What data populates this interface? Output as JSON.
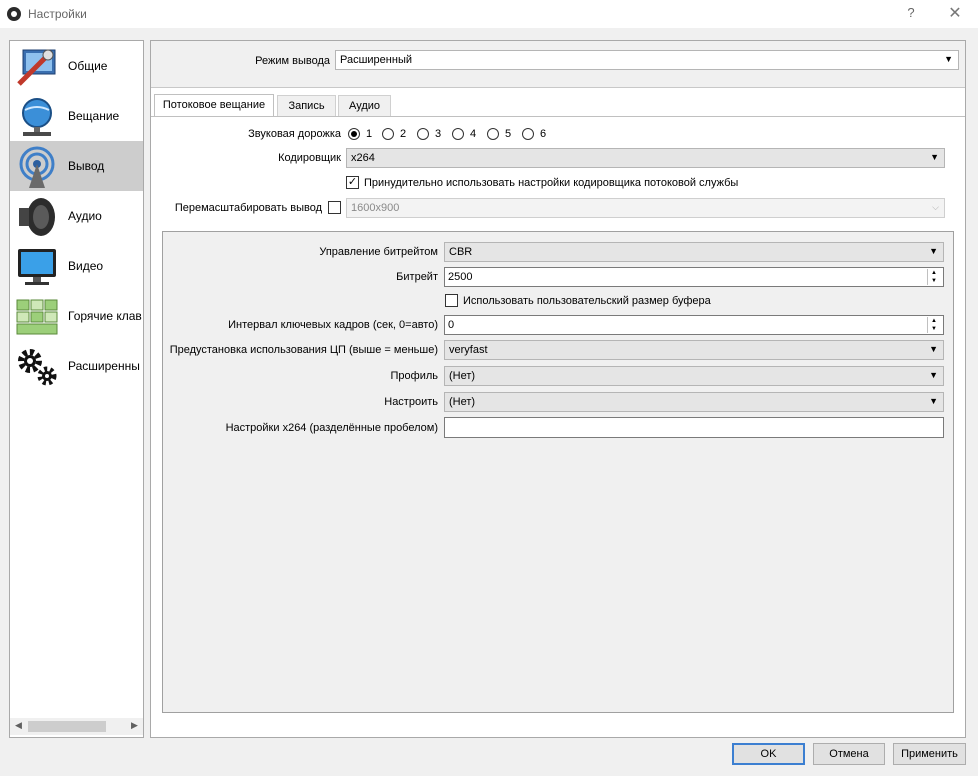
{
  "window": {
    "title": "Настройки",
    "help": "?",
    "close": "✕"
  },
  "sidebar": {
    "items": [
      {
        "label": "Общие",
        "icon": "general-settings-icon"
      },
      {
        "label": "Вещание",
        "icon": "stream-globe-icon"
      },
      {
        "label": "Вывод",
        "icon": "output-broadcast-icon",
        "selected": true
      },
      {
        "label": "Аудио",
        "icon": "speaker-icon"
      },
      {
        "label": "Видео",
        "icon": "monitor-icon"
      },
      {
        "label": "Горячие клав",
        "icon": "keyboard-icon"
      },
      {
        "label": "Расширенны",
        "icon": "gears-icon"
      }
    ]
  },
  "output_mode": {
    "label": "Режим вывода",
    "value": "Расширенный"
  },
  "tabs": [
    {
      "label": "Потоковое вещание",
      "active": true
    },
    {
      "label": "Запись"
    },
    {
      "label": "Аудио"
    }
  ],
  "streaming": {
    "audio_track": {
      "label": "Звуковая дорожка",
      "options": [
        "1",
        "2",
        "3",
        "4",
        "5",
        "6"
      ],
      "selected": "1"
    },
    "encoder": {
      "label": "Кодировщик",
      "value": "x264"
    },
    "enforce": {
      "label": "Принудительно использовать настройки кодировщика потоковой службы",
      "checked": true
    },
    "rescale": {
      "label": "Перемасштабировать вывод",
      "checked": false,
      "value": "1600x900"
    }
  },
  "encoder_settings": {
    "rate_control": {
      "label": "Управление битрейтом",
      "value": "CBR"
    },
    "bitrate": {
      "label": "Битрейт",
      "value": "2500"
    },
    "custom_buffer": {
      "label": "Использовать пользовательский размер буфера",
      "checked": false
    },
    "keyframe": {
      "label": "Интервал ключевых кадров (сек, 0=авто)",
      "value": "0"
    },
    "cpu_preset": {
      "label": "Предустановка использования ЦП (выше = меньше)",
      "value": "veryfast"
    },
    "profile": {
      "label": "Профиль",
      "value": "(Нет)"
    },
    "tune": {
      "label": "Настроить",
      "value": "(Нет)"
    },
    "x264opts": {
      "label": "Настройки x264 (разделённые пробелом)",
      "value": ""
    }
  },
  "buttons": {
    "ok": "OK",
    "cancel": "Отмена",
    "apply": "Применить"
  }
}
